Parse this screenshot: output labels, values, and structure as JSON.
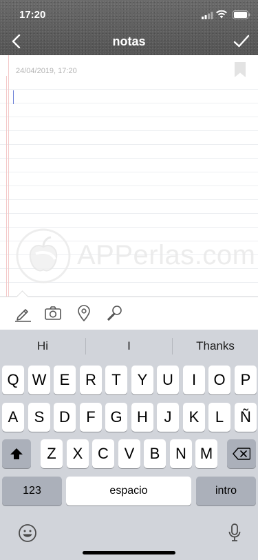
{
  "status": {
    "time": "17:20"
  },
  "nav": {
    "title": "notas",
    "back_icon": "chevron-left-icon",
    "done_icon": "checkmark-icon"
  },
  "note": {
    "date": "24/04/2019, 17:20",
    "body": ""
  },
  "watermark": {
    "text": "APPerlas.com"
  },
  "toolbar": {
    "tools": [
      "pencil-icon",
      "camera-icon",
      "location-pin-icon",
      "microphone-icon"
    ]
  },
  "keyboard": {
    "suggestions": [
      "Hi",
      "I",
      "Thanks"
    ],
    "row1": [
      "Q",
      "W",
      "E",
      "R",
      "T",
      "Y",
      "U",
      "I",
      "O",
      "P"
    ],
    "row2": [
      "A",
      "S",
      "D",
      "F",
      "G",
      "H",
      "J",
      "K",
      "L",
      "Ñ"
    ],
    "row3": [
      "Z",
      "X",
      "C",
      "V",
      "B",
      "N",
      "M"
    ],
    "numbers_label": "123",
    "space_label": "espacio",
    "return_label": "intro"
  }
}
